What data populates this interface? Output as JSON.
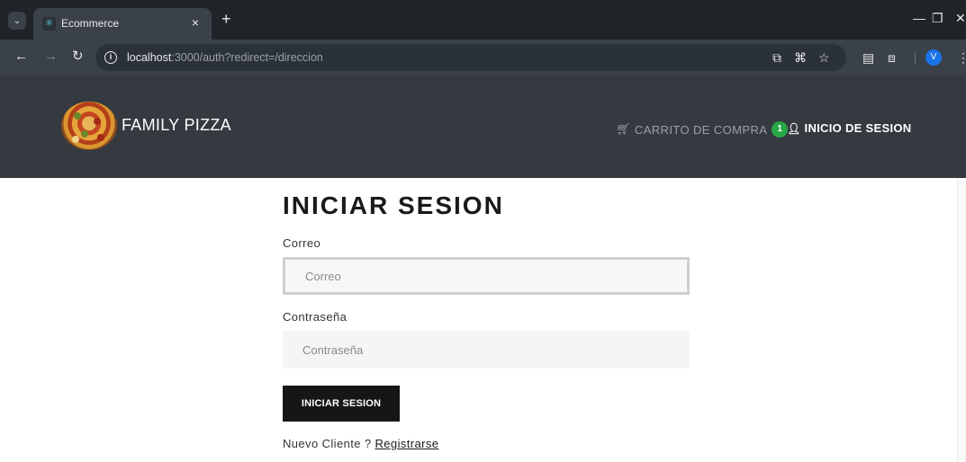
{
  "browser": {
    "tab_title": "Ecommerce",
    "tab_close": "×",
    "new_tab": "+",
    "url_host": "localhost",
    "url_rest": ":3000/auth?redirect=/direccion",
    "profile_initial": "V"
  },
  "header": {
    "brand": "FAMILY PIZZA",
    "cart_label": "CARRITO DE COMPRA",
    "cart_count": "1",
    "login_label": "INICIO DE SESION"
  },
  "form": {
    "title": "INICIAR SESION",
    "email_label": "Correo",
    "email_placeholder": "Correo",
    "password_label": "Contraseña",
    "password_placeholder": "Contraseña",
    "submit_label": "INICIAR SESION",
    "new_customer_text": "Nuevo Cliente ?",
    "register_link": "Registrarse"
  },
  "colors": {
    "header_bg": "#343a40",
    "badge": "#28a745",
    "button_bg": "#161616"
  }
}
